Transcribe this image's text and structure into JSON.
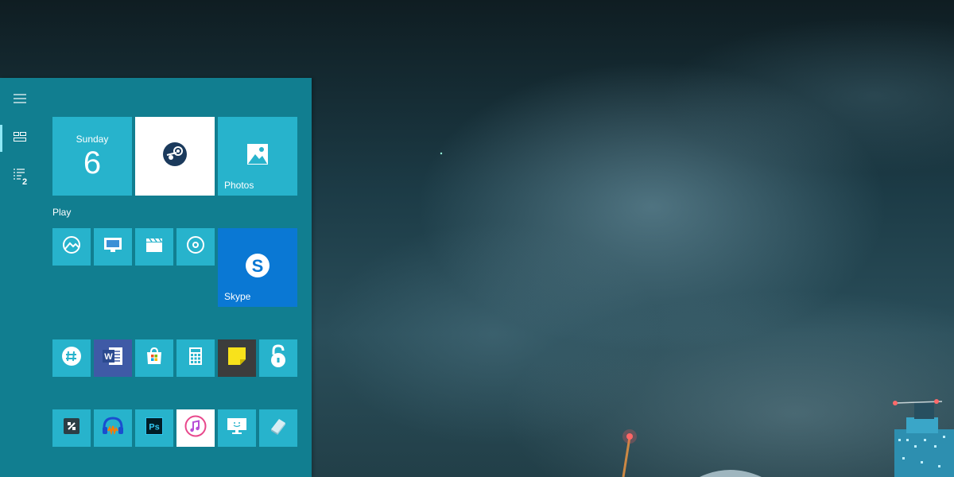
{
  "start_menu": {
    "rail": {
      "hamburger_icon": "hamburger-menu-icon",
      "tiles_view_icon": "tiles-view-icon",
      "all_apps_icon": "all-apps-list-icon",
      "all_apps_badge": "2"
    },
    "top_tiles": {
      "calendar": {
        "day": "Sunday",
        "date": "6"
      },
      "steam": {
        "icon": "steam-icon"
      },
      "photos": {
        "label": "Photos",
        "icon": "photos-icon"
      }
    },
    "play_group": {
      "title": "Play",
      "skype": {
        "label": "Skype",
        "icon": "skype-icon"
      }
    }
  },
  "colors": {
    "start_bg": "#117e90",
    "tile": "#27b3cc",
    "skype": "#0a78d4",
    "word": "#3f5aa6",
    "sticky": "#3c3c3c"
  }
}
